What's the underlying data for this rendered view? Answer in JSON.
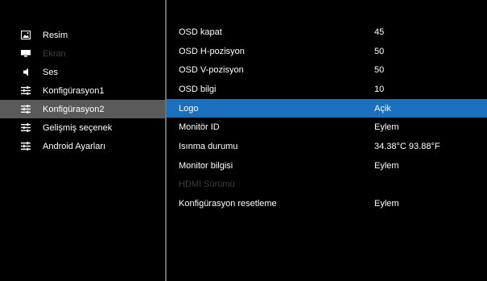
{
  "sidebar": {
    "items": [
      {
        "label": "Resim",
        "icon": "picture-icon"
      },
      {
        "label": "Ekran",
        "icon": "screen-icon"
      },
      {
        "label": "Ses",
        "icon": "speaker-icon"
      },
      {
        "label": "Konfigürasyon1",
        "icon": "settings-sliders-icon"
      },
      {
        "label": "Konfigürasyon2",
        "icon": "settings-sliders-icon"
      },
      {
        "label": "Gelişmiş seçenek",
        "icon": "settings-sliders-icon"
      },
      {
        "label": "Android Ayarları",
        "icon": "settings-sliders-icon"
      }
    ],
    "selected_label": "Konfigürasyon2",
    "disabled_label": "Ekran"
  },
  "settings": {
    "rows": [
      {
        "label": "OSD kapat",
        "value": "45"
      },
      {
        "label": "OSD H-pozisyon",
        "value": "50"
      },
      {
        "label": "OSD V-pozisyon",
        "value": "50"
      },
      {
        "label": "OSD bilgi",
        "value": "10"
      },
      {
        "label": "Logo",
        "value": "Açik"
      },
      {
        "label": "Monitör ID",
        "value": "Eylem"
      },
      {
        "label": "Isınma durumu",
        "value": "34.38°C 93.88°F"
      },
      {
        "label": "Monitor bilgisi",
        "value": "Eylem"
      },
      {
        "label": "HDMI Sürümü",
        "value": ""
      },
      {
        "label": "Konfigürasyon resetleme",
        "value": "Eylem"
      }
    ],
    "selected_label": "Logo",
    "disabled_label": "HDMI Sürümü"
  },
  "colors": {
    "background": "#000000",
    "sidebar_selected": "#5a5a5a",
    "row_selected": "#1a6fbf",
    "disabled_text": "#3e3e3e",
    "divider": "#6f6f6f"
  }
}
